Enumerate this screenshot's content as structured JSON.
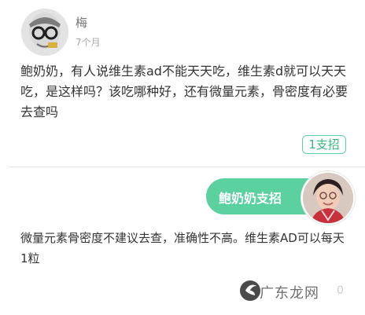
{
  "question": {
    "user_name": "梅",
    "time": "7个月",
    "text": "鲍奶奶，有人说维生素ad不能天天吃，维生素d就可以天天吃，是这样吗？该吃哪种好，还有微量元素，骨密度有必要去查吗",
    "support_label": "1支招"
  },
  "answer": {
    "responder_label": "鲍奶奶支招",
    "text": "微量元素骨密度不建议去查，准确性不高。维生素AD可以每天1粒"
  },
  "watermark": {
    "text": "广东龙网"
  },
  "footer": {
    "count_fragment": "0"
  },
  "colors": {
    "accent": "#5bd19f",
    "accent_text": "#39b97f",
    "text": "#333333",
    "muted": "#aaaaaa"
  },
  "icons": {
    "question_avatar": "avatar-user-glasses",
    "answer_avatar": "avatar-grandma-photo",
    "watermark": "guangdong-longwang-watermark-logo"
  }
}
